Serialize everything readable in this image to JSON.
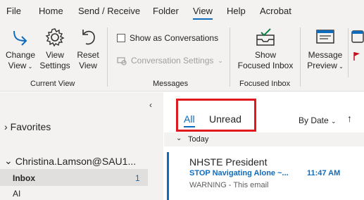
{
  "menu": {
    "tabs": [
      "File",
      "Home",
      "Send / Receive",
      "Folder",
      "View",
      "Help",
      "Acrobat"
    ],
    "active": "View"
  },
  "ribbon": {
    "current_view": {
      "change_view": "Change\nView",
      "view_settings": "View\nSettings",
      "reset_view": "Reset\nView",
      "label": "Current View"
    },
    "messages": {
      "show_as_conversations": "Show as Conversations",
      "conversation_settings": "Conversation Settings",
      "label": "Messages"
    },
    "focused_inbox": {
      "show_focused_inbox": "Show\nFocused Inbox",
      "label": "Focused Inbox"
    },
    "layout": {
      "message_preview": "Message\nPreview"
    }
  },
  "folders": {
    "favorites": "Favorites",
    "account": "Christina.Lamson@SAU1...",
    "inbox": "Inbox",
    "inbox_count": "1",
    "ai": "AI"
  },
  "list": {
    "filter_all": "All",
    "filter_unread": "Unread",
    "sort": "By Date",
    "group": "Today",
    "message": {
      "from": "NHSTE President",
      "subject": "STOP Navigating Alone ~...",
      "time": "11:47 AM",
      "preview": "WARNING - This email"
    }
  },
  "colors": {
    "accent": "#0f6cbd",
    "highlight_box": "#e0191e"
  }
}
